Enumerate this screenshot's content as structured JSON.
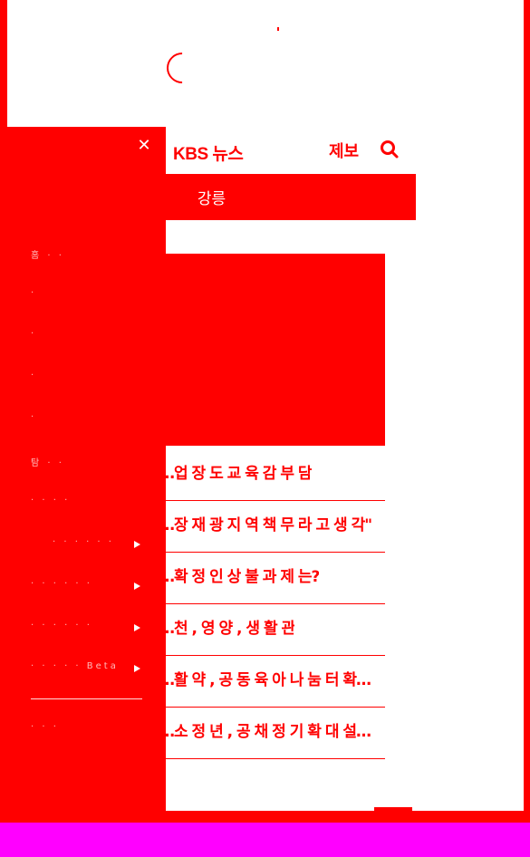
{
  "header": {
    "logo": "KBS 뉴스",
    "tip_label": "제보",
    "search_icon": "search-icon"
  },
  "region": {
    "name": "강릉"
  },
  "news": [
    {
      "title": "…업 장 도 교 육 감 부 담"
    },
    {
      "title": "…장 재 광 지 역 책 무 라 고 생 각\""
    },
    {
      "title": "…확 정 인 상 불 과 제 는?"
    },
    {
      "title": "…천 , 영 양 , 생 활 관"
    },
    {
      "title": "…활 약 , 공 동 육 아 나 눔 터 확…"
    },
    {
      "title": "…소 정 년 , 공 채 정 기 확 대 설…"
    }
  ],
  "sidebar": {
    "close_icon": "close-icon",
    "items": [
      {
        "label": "홈 · ·"
      },
      {
        "label": "·"
      },
      {
        "label": "·"
      },
      {
        "label": "·"
      },
      {
        "label": "·"
      },
      {
        "label": "탐 · ·"
      },
      {
        "label": "· · · ·"
      },
      {
        "label": "· · · · · ·",
        "has_arrow": true
      },
      {
        "label": "· · · · · ·",
        "has_arrow": true
      },
      {
        "label": "· · · · · ·",
        "has_arrow": true
      },
      {
        "label": "· · · · · Beta",
        "has_arrow": true
      }
    ],
    "footer_item": {
      "label": "· · ·"
    }
  },
  "colors": {
    "accent": "#ff0000",
    "background": "#ffffff",
    "canvas": "#ff00ff"
  }
}
